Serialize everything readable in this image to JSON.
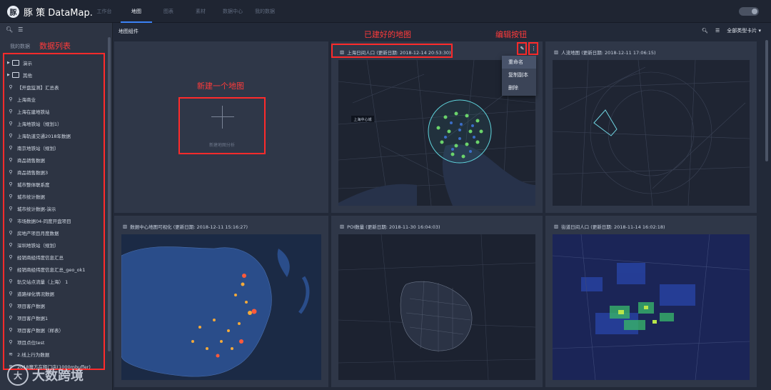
{
  "app": {
    "brand": "豚 策 DataMap.",
    "brand_mark": "豚"
  },
  "nav": {
    "items": [
      "工作台",
      "地图",
      "图表",
      "素材",
      "数据中心",
      "我的数据"
    ],
    "active_index": 1
  },
  "sidebar": {
    "tab": "我的数据",
    "annotation": "数据列表",
    "items": [
      {
        "type": "folder",
        "label": "演示"
      },
      {
        "type": "folder",
        "label": "其他"
      },
      {
        "type": "pin",
        "label": "【开盘监测】汇总表"
      },
      {
        "type": "pin",
        "label": "上海商业"
      },
      {
        "type": "pin",
        "label": "上海在建地铁站"
      },
      {
        "type": "pin",
        "label": "上海地铁站（规划1）"
      },
      {
        "type": "pin",
        "label": "上海轨道交通2018年数据"
      },
      {
        "type": "pin",
        "label": "南京地铁站（规划）"
      },
      {
        "type": "pin",
        "label": "商品销售数据"
      },
      {
        "type": "pin",
        "label": "商品销售数据3"
      },
      {
        "type": "pin",
        "label": "城市整体联系度"
      },
      {
        "type": "pin",
        "label": "城市统计数据"
      },
      {
        "type": "pin",
        "label": "城市统计数据-演示"
      },
      {
        "type": "pin",
        "label": "市场数据04-同度开盘项目"
      },
      {
        "type": "pin",
        "label": "房地产项目月度数据"
      },
      {
        "type": "pin",
        "label": "深圳地铁站（规划）"
      },
      {
        "type": "pin",
        "label": "经销商经纬度信息汇总"
      },
      {
        "type": "pin",
        "label": "经销商经纬度信息汇总_geo_ok1"
      },
      {
        "type": "pin",
        "label": "轨交站点流量（上海） 1"
      },
      {
        "type": "pin",
        "label": "道路绿化情况数据"
      },
      {
        "type": "pin",
        "label": "项目客户数据"
      },
      {
        "type": "pin",
        "label": "项目客户数据1"
      },
      {
        "type": "pin",
        "label": "项目客户数据（样表）"
      },
      {
        "type": "pin",
        "label": "项目点位test"
      },
      {
        "type": "line",
        "label": "2.线上行为数据"
      },
      {
        "type": "line",
        "label": "2018魔方在租门店(1000mbuffer)"
      }
    ]
  },
  "main": {
    "header": "地图组件",
    "filter_label": "全部类型卡片",
    "new_map": {
      "annotation": "新建一个地图",
      "label": "新建地图分析"
    },
    "cards": [
      {
        "title": "上海日间人口 (更新日期: 2018-12-14 20:53:30)",
        "annotation": "已建好的地图",
        "map_label": "上海中心城"
      },
      {
        "title": "人流地图 (更新日期: 2018-12-11 17:06:15)"
      },
      {
        "title": "数据中心地图可视化 (更新日期: 2018-12-11 15:16:27)"
      },
      {
        "title": "POI数量 (更新日期: 2018-11-30 16:04:03)"
      },
      {
        "title": "街道日间人口 (更新日期: 2018-11-14 16:02:18)"
      }
    ],
    "edit_annotation": "编辑按钮",
    "menu": [
      "重命名",
      "复制副本",
      "删除"
    ]
  },
  "watermark": {
    "text": "大数跨境",
    "mark": "大"
  },
  "colors": {
    "accent": "#3b82f6",
    "annotation": "#ff2b2b",
    "panel": "#2f3748"
  }
}
